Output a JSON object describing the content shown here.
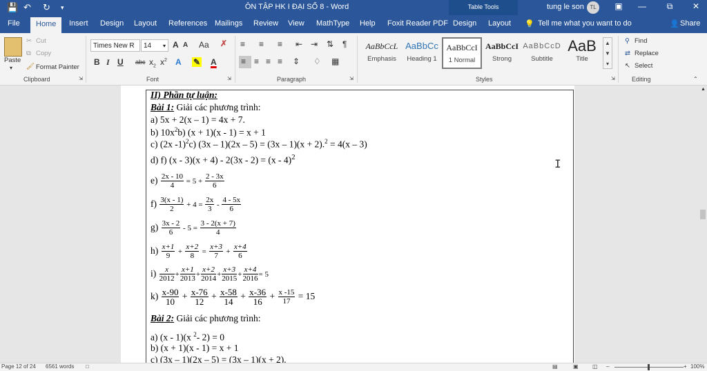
{
  "title_bar": {
    "title": "ÔN TẬP HK I ĐẠI SỐ 8  -  Word",
    "table_tools": "Table Tools",
    "user_name": "tung le son",
    "user_initials": "TL",
    "icons": [
      "save-icon",
      "undo-icon",
      "redo-icon",
      "customize-qat-icon",
      "ribbon-display-icon",
      "minimize-icon",
      "restore-icon",
      "close-icon"
    ]
  },
  "tabs": [
    "File",
    "Home",
    "Insert",
    "Design",
    "Layout",
    "References",
    "Mailings",
    "Review",
    "View",
    "MathType",
    "Help",
    "Foxit Reader PDF",
    "Design",
    "Layout"
  ],
  "active_tab": "Home",
  "tell_me": "Tell me what you want to do",
  "share": "Share",
  "clipboard": {
    "paste": "Paste",
    "cut": "Cut",
    "copy": "Copy",
    "format_painter": "Format Painter",
    "label": "Clipboard"
  },
  "font": {
    "name": "Times New R",
    "size": "14",
    "grow": "A",
    "shrink": "A",
    "case": "Aa",
    "bold": "B",
    "italic": "I",
    "underline": "U",
    "strike": "abc",
    "sub": "x",
    "sup": "x",
    "label": "Font"
  },
  "paragraph": {
    "label": "Paragraph",
    "pilcrow": "¶"
  },
  "styles": {
    "label": "Styles",
    "items": [
      {
        "preview": "AaBbCcL",
        "name": "Emphasis"
      },
      {
        "preview": "AaBbCc",
        "name": "Heading 1"
      },
      {
        "preview": "AaBbCcI",
        "name": "1 Normal"
      },
      {
        "preview": "AaBbCcI",
        "name": "Strong"
      },
      {
        "preview": "AaBbCcD",
        "name": "Subtitle"
      },
      {
        "preview": "AaB",
        "name": "Title"
      }
    ]
  },
  "editing": {
    "find": "Find",
    "replace": "Replace",
    "select": "Select",
    "label": "Editing"
  },
  "document": {
    "heading": "II) Phần tự luận:",
    "bai1_label": "Bài 1:",
    "bai1_text": " Giải các phương trình:",
    "a": "a) 5x + 2(x – 1) = 4x + 7.",
    "b1": "b) 10x",
    "b_sup": "2",
    "b2": "b) (x + 1)(x - 1) = x +  1",
    "c1": "c) (2x -1)",
    "c_sup1": "2",
    "c2": "c) (3x – 1)(2x – 5) = (3x – 1)(x + 2).",
    "c_sup2": "2",
    "c3": " = 4(x – 3)",
    "d": "d) f)  (x - 3)(x + 4) - 2(3x - 2) = (x - 4)",
    "d_sup": "2",
    "e_label": "e)",
    "e": {
      "n1": "2x - 10",
      "d1": "4",
      "mid": " = 5 + ",
      "n2": "2 - 3x",
      "d2": "6"
    },
    "f_label": "f)",
    "f": {
      "n1": "3(x - 1)",
      "d1": "2",
      "mid": " + 4 = ",
      "n2": "2x",
      "d2": "3",
      "mid2": " - ",
      "n3": "4 - 5x",
      "d3": "6"
    },
    "g_label": "g)",
    "g": {
      "n1": "3x - 2",
      "d1": "6",
      "mid": " - 5 = ",
      "n2": "3 - 2(x + 7)",
      "d2": "4"
    },
    "h_label": "h)",
    "h": {
      "n1": "x+1",
      "d1": "9",
      "n2": "x+2",
      "d2": "8",
      "n3": "x+3",
      "d3": "7",
      "n4": "x+4",
      "d4": "6"
    },
    "i_label": "i)",
    "i": {
      "n1": "x",
      "d1": "2012",
      "n2": "x+1",
      "d2": "2013",
      "n3": "x+2",
      "d3": "2014",
      "n4": "x+3",
      "d4": "2015",
      "n5": "x+4",
      "d5": "2016",
      "rhs": "= 5"
    },
    "k_label": "k)",
    "k": {
      "n1": "x-90",
      "d1": "10",
      "n2": "x-76",
      "d2": "12",
      "n3": "x-58",
      "d3": "14",
      "n4": "x-36",
      "d4": "16",
      "n5": "x -15",
      "d5": "17",
      "rhs": "= 15"
    },
    "bai2_label": "Bài 2:",
    "bai2_text": " Giải các phương trình:",
    "a2_1": "a) (x - 1)(x ",
    "a2_sup": "2",
    "a2_2": "- 2)  = 0"
  },
  "status": {
    "page": "Page 12 of 24",
    "words": "6561 words",
    "zoom": "100%"
  }
}
